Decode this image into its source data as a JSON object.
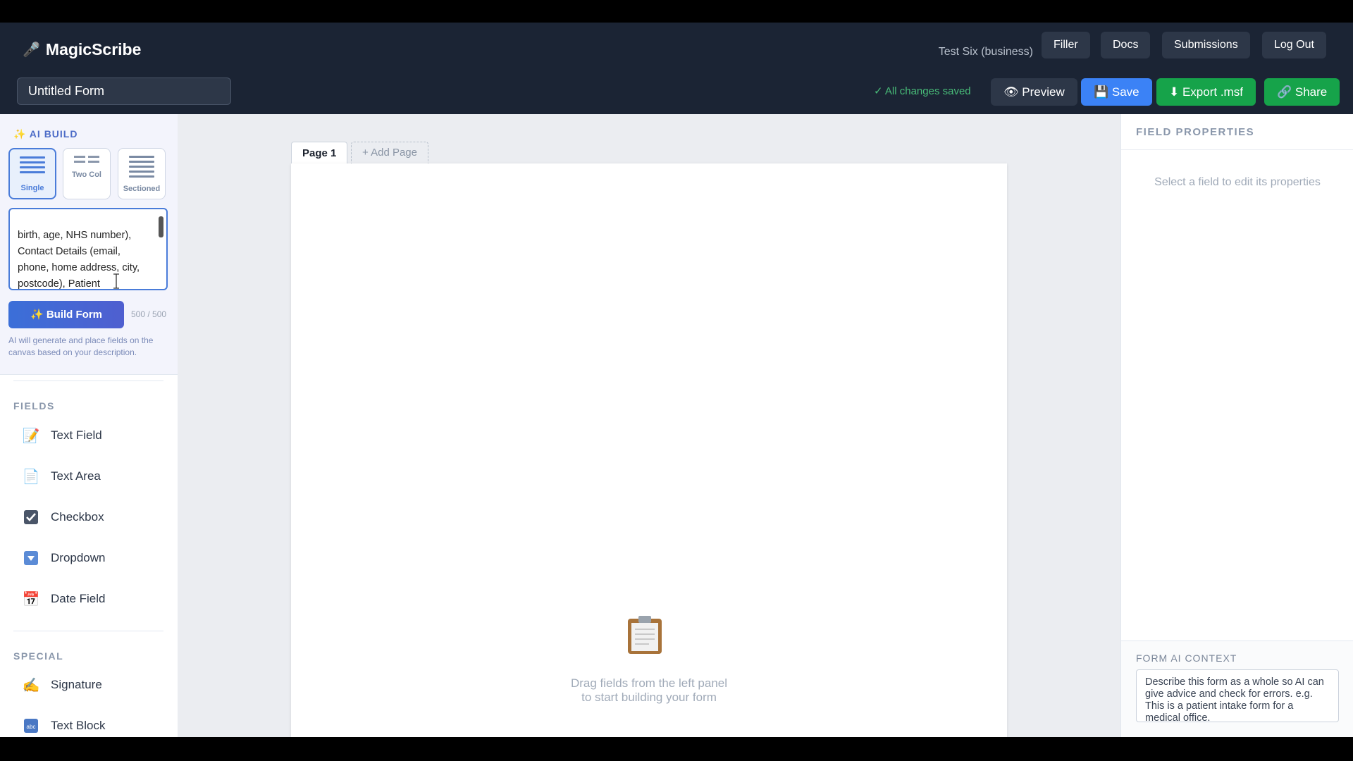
{
  "header": {
    "brand": "MagicScribe",
    "user": "Test Six (business)",
    "nav": [
      {
        "label": "Filler"
      },
      {
        "label": "Docs"
      },
      {
        "label": "Submissions"
      },
      {
        "label": "Log Out"
      }
    ],
    "form_title": "Untitled Form",
    "save_status": "✓ All changes saved",
    "actions": {
      "preview": "👁 Preview",
      "save": "💾 Save",
      "export": "⬇ Export .msf",
      "share": "🔗 Share"
    }
  },
  "sidebar": {
    "ai_build": {
      "title": "✨ AI BUILD",
      "layouts": [
        {
          "label": "Single",
          "selected": true
        },
        {
          "label": "Two Col",
          "selected": false
        },
        {
          "label": "Sectioned",
          "selected": false
        }
      ],
      "prompt_text": "birth, age, NHS number),\nContact Details (email,\nphone, home address, city,\npostcode), Patient\nDemographics (gender as",
      "build_button": "✨ Build Form",
      "char_count": "500 / 500",
      "help": "AI will generate and place fields on the canvas based on your description."
    },
    "fields_title": "FIELDS",
    "fields": [
      {
        "label": "Text Field",
        "icon": "memo-icon"
      },
      {
        "label": "Text Area",
        "icon": "page-icon"
      },
      {
        "label": "Checkbox",
        "icon": "checkbox-icon"
      },
      {
        "label": "Dropdown",
        "icon": "dropdown-icon"
      },
      {
        "label": "Date Field",
        "icon": "calendar-icon"
      }
    ],
    "special_title": "SPECIAL",
    "special": [
      {
        "label": "Signature",
        "icon": "writing-hand-icon"
      },
      {
        "label": "Text Block",
        "icon": "abc-icon"
      }
    ]
  },
  "canvas": {
    "tabs": [
      {
        "label": "Page 1",
        "active": true
      }
    ],
    "add_page": "+ Add Page",
    "empty_line1": "Drag fields from the left panel",
    "empty_line2": "to start building your form"
  },
  "properties": {
    "title": "FIELD PROPERTIES",
    "empty": "Select a field to edit its properties",
    "context_title": "FORM AI CONTEXT",
    "context_placeholder": "Describe this form as a whole so AI can give advice and check for errors. e.g. This is a patient intake form for a medical office."
  }
}
